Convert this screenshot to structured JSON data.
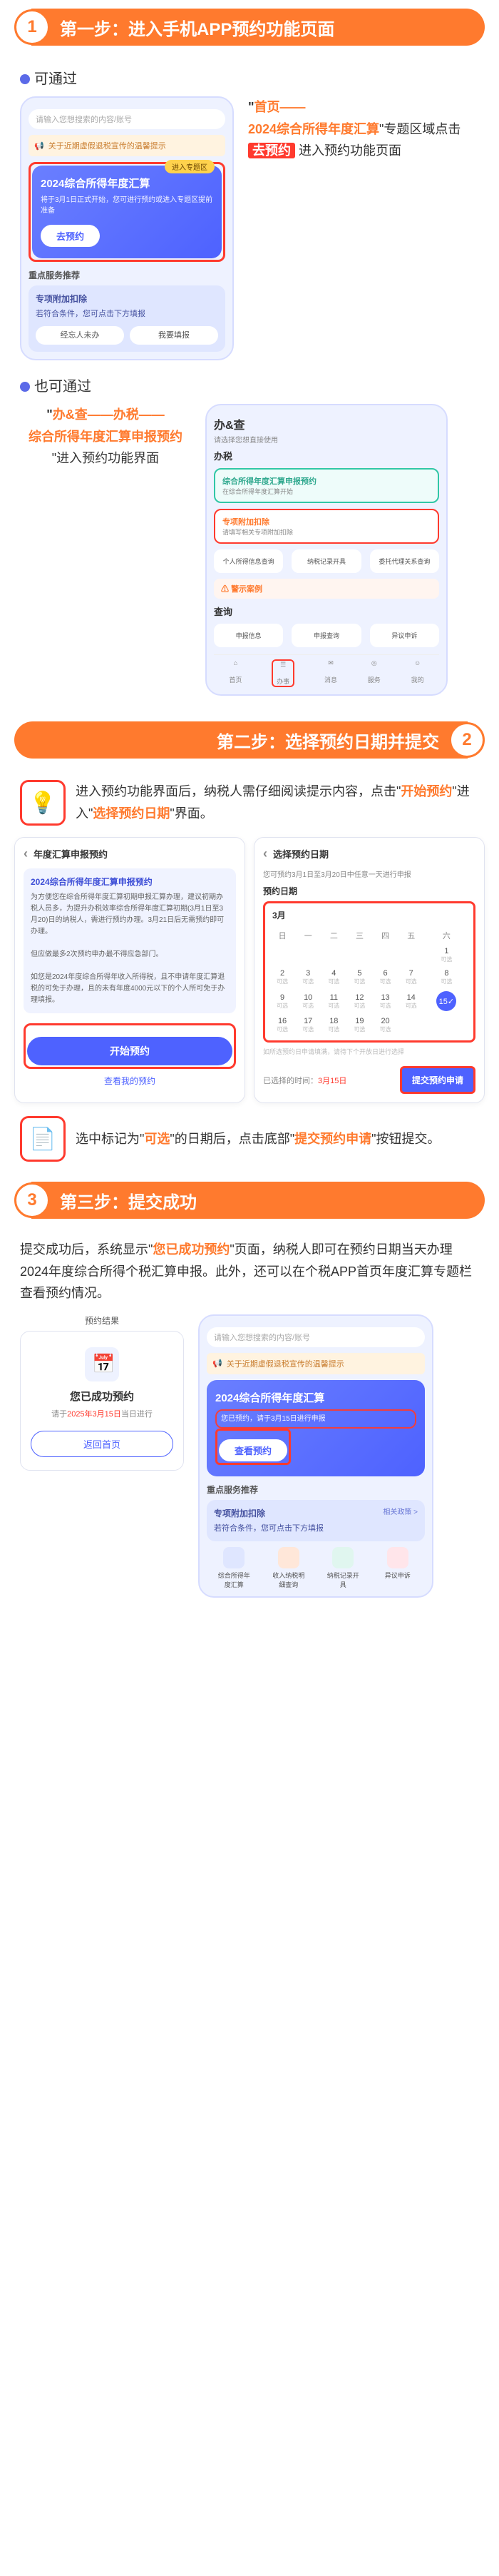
{
  "step1": {
    "num": "1",
    "title": "第一步：进入手机APP预约功能页面",
    "via1": "可通过",
    "via2": "也可通过",
    "side1": {
      "a": "\"",
      "home": "首页——",
      "topic": "2024综合所得年度汇算",
      "mid": "\"专题区域点击",
      "btn": "去预约",
      "tail": "进入预约功能页面"
    },
    "side2": {
      "a": "\"",
      "l1": "办&查——办税——",
      "l2": "综合所得年度汇算申报预约",
      "tail": "\"进入预约功能界面"
    },
    "phone1": {
      "search": "请输入您想搜索的内容/账号",
      "warn": "关于近期虚假退税宣传的温馨提示",
      "tag": "进入专题区",
      "pt": "2024综合所得年度汇算",
      "ps": "将于3月1日正式开始，您可进行预约或进入专题区提前准备",
      "go": "去预约",
      "mh": "重点服务推荐",
      "card2h": "专项附加扣除",
      "card2s": "若符合条件，您可点击下方填报",
      "pill1": "经忘人未办",
      "pill2": "我要填报"
    },
    "phone2": {
      "head": "办&查",
      "sub": "请选择您想直接使用",
      "bt": "办税",
      "green_t": "综合所得年度汇算申报预约",
      "green_s": "在综合所得年度汇算开始",
      "red_t": "专项附加扣除",
      "red_s": "请填写相关专项附加扣除",
      "k1": "个人所得信息查询",
      "k2": "纳税记录开具",
      "k3": "委托代理关系查询",
      "warn_t": "警示案例",
      "q": "查询",
      "k4": "申报信息",
      "k5": "申报查询",
      "k6": "异议申诉",
      "nav": [
        "首页",
        "办事",
        "消息",
        "服务",
        "我的"
      ]
    }
  },
  "step2": {
    "num": "2",
    "title": "第二步：选择预约日期并提交",
    "intro": "进入预约功能界面后，纳税人需仔细阅读提示内容，点击\"",
    "intro_b": "开始预约",
    "intro_c": "\"进入\"",
    "intro_d": "选择预约日期",
    "intro_e": "\"界面。",
    "p1": {
      "head": "年度汇算申报预约",
      "t": "2024综合所得年度汇算申报预约",
      "body": "为方便您在综合所得年度汇算初期申报汇算办理，建议初期办税人员多，为提升办税效率综合所得年度汇算初期(3月1日至3月20)日的纳税人，需进行预约办理。3月21日后无需预约即可办理。",
      "body2": "但应做最多2次预约申办最不得应急部门。",
      "body3": "如您是2024年度综合所得年收入所得税，且不申请年度汇算退税的可免于办理，且的未有年度4000元以下的个人所可免于办理填报。",
      "start": "开始预约",
      "look": "查看我的预约"
    },
    "p2": {
      "head": "选择预约日期",
      "hint": "您可预约3月1日至3月20日中任意一天进行申报",
      "dh": "预约日期",
      "month": "3月",
      "wk": [
        "日",
        "一",
        "二",
        "三",
        "四",
        "五",
        "六"
      ],
      "note": "如所选预约日申请填满，请待下个开放日进行选择",
      "sel_l": "已选择的时间：",
      "sel_v": "3月15日",
      "submit": "提交预约申请"
    },
    "after": {
      "a": "选中标记为\"",
      "b": "可选",
      "c": "\"的日期后，点击底部\"",
      "d": "提交预约申请",
      "e": "\"按钮提交。"
    }
  },
  "step3": {
    "num": "3",
    "title": "第三步：提交成功",
    "intro_a": "提交成功后，系统显示\"",
    "intro_b": "您已成功预约",
    "intro_c": "\"页面，纳税人即可在预约日期当天办理2024年度综合所得个税汇算申报。此外，还可以在个税APP首页年度汇算专题栏查看预约情况。",
    "box": {
      "head": "预约结果",
      "t": "您已成功预约",
      "s1": "请于",
      "s2": "2025年3月15日",
      "s3": "当日进行",
      "back": "返回首页"
    },
    "phone": {
      "search": "请输入您想搜索的内容/账号",
      "warn": "关于近期虚假退税宣传的温馨提示",
      "pt": "2024综合所得年度汇算",
      "ps": "您已预约，请于3月15日进行申报",
      "view": "查看预约",
      "mh": "重点服务推荐",
      "zh": "专项附加扣除",
      "zs": "若符合条件，您可点击下方填报",
      "rel": "相关政策 >",
      "i1": "综合所得年度汇算",
      "i2": "收入纳税明细查询",
      "i3": "纳税记录开具",
      "i4": "异议申诉"
    }
  }
}
